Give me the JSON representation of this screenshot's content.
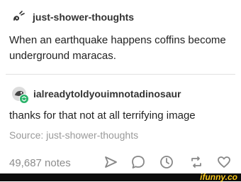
{
  "post": {
    "username": "just-shower-thoughts",
    "text": "When an earthquake happens coffins become underground maracas."
  },
  "reply": {
    "username": "ialreadytoldyouimnotadinosaur",
    "text": "thanks for that not at all terrifying image"
  },
  "source": {
    "text": "Source: just-shower-thoughts"
  },
  "footer": {
    "notes": "49,687 notes",
    "actions": {
      "share": "send-icon",
      "reply": "chat-bubble-icon",
      "queue": "clock-icon",
      "reblog": "reblog-icon",
      "like": "heart-icon"
    }
  },
  "watermark": {
    "text": "ifunny.co",
    "color": "#f5c518"
  },
  "colors": {
    "reply_badge": "#2bb36a",
    "muted_text": "#8c8c8c",
    "divider": "#e2e2e2"
  }
}
